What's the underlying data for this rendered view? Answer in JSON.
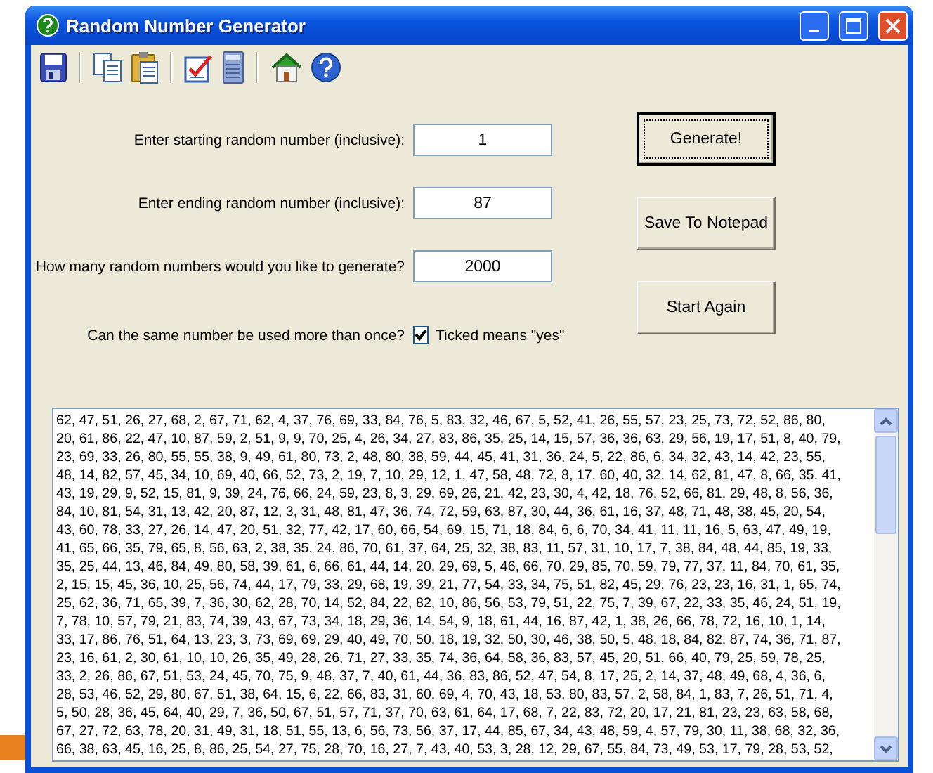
{
  "window": {
    "title": "Random Number Generator"
  },
  "toolbar": [
    {
      "kind": "save"
    },
    {
      "kind": "separator"
    },
    {
      "kind": "copy"
    },
    {
      "kind": "paste"
    },
    {
      "kind": "separator"
    },
    {
      "kind": "checklist"
    },
    {
      "kind": "calculator"
    },
    {
      "kind": "separator"
    },
    {
      "kind": "home"
    },
    {
      "kind": "help"
    }
  ],
  "fields": [
    {
      "label": "Enter starting random number (inclusive):",
      "value": "1"
    },
    {
      "label": "Enter ending random number (inclusive):",
      "value": "87"
    },
    {
      "label": "How many random numbers would you like to generate?",
      "value": "2000"
    }
  ],
  "reuse": {
    "label": "Can the same number be used more than once?",
    "checkbox_label": "Ticked means \"yes\"",
    "checked": true
  },
  "buttons": [
    {
      "label": "Generate!",
      "default": true
    },
    {
      "label": "Save To Notepad",
      "default": false
    },
    {
      "label": "Start Again",
      "default": false
    }
  ],
  "output": {
    "lines": [
      "62, 47, 51, 26, 27, 68, 2, 67, 71, 62, 4, 37, 76, 69, 33, 84, 76, 5, 83, 32, 46, 67, 5, 52, 41, 26, 55, 57, 23, 25, 73, 72, 52, 86, 80,",
      "20, 61, 86, 22, 47, 10, 87, 59, 2, 51, 9, 9, 70, 25, 4, 26, 34, 27, 83, 86, 35, 25, 14, 15, 57, 36, 36, 63, 29, 56, 19, 17, 51, 8, 40, 79,",
      "23, 69, 33, 26, 80, 55, 55, 38, 9, 49, 61, 80, 73, 2, 48, 80, 38, 59, 44, 45, 41, 31, 36, 24, 5, 22, 86, 6, 34, 32, 43, 14, 42, 23, 55,",
      "48, 14, 82, 57, 45, 34, 10, 69, 40, 66, 52, 73, 2, 19, 7, 10, 29, 12, 1, 47, 58, 48, 72, 8, 17, 60, 40, 32, 14, 62, 81, 47, 8, 66, 35, 41,",
      "43, 19, 29, 9, 52, 15, 81, 9, 39, 24, 76, 66, 24, 59, 23, 8, 3, 29, 69, 26, 21, 42, 23, 30, 4, 42, 18, 76, 52, 66, 81, 29, 48, 8, 56, 36,",
      "84, 10, 81, 54, 31, 13, 42, 20, 87, 12, 3, 31, 48, 81, 47, 36, 74, 72, 59, 63, 87, 30, 44, 36, 61, 16, 37, 48, 71, 48, 38, 45, 20, 54,",
      "43, 60, 78, 33, 27, 26, 14, 47, 20, 51, 32, 77, 42, 17, 60, 66, 54, 69, 15, 71, 18, 84, 6, 6, 70, 34, 41, 11, 11, 16, 5, 63, 47, 49, 19,",
      "41, 65, 66, 35, 79, 65, 8, 56, 63, 2, 38, 35, 24, 86, 70, 61, 37, 64, 25, 32, 38, 83, 11, 57, 31, 10, 17, 7, 38, 84, 48, 44, 85, 19, 33,",
      "35, 25, 44, 13, 46, 84, 49, 80, 58, 39, 61, 6, 66, 61, 44, 14, 20, 29, 69, 5, 46, 66, 70, 29, 85, 70, 59, 79, 77, 37, 11, 84, 70, 61, 35,",
      "2, 15, 15, 45, 36, 10, 25, 56, 74, 44, 17, 79, 33, 29, 68, 19, 39, 21, 77, 54, 33, 34, 75, 51, 82, 45, 29, 76, 23, 23, 16, 31, 1, 65, 74,",
      "25, 62, 36, 71, 65, 39, 7, 36, 30, 62, 28, 70, 14, 52, 84, 22, 82, 10, 86, 56, 53, 79, 51, 22, 75, 7, 39, 67, 22, 33, 35, 46, 24, 51, 19,",
      "7, 78, 10, 57, 79, 21, 83, 74, 39, 43, 67, 73, 34, 18, 29, 36, 14, 54, 9, 18, 61, 44, 16, 87, 42, 1, 38, 26, 66, 78, 72, 16, 10, 1, 14,",
      "33, 17, 86, 76, 51, 64, 13, 23, 3, 73, 69, 69, 29, 40, 49, 70, 50, 18, 19, 32, 50, 30, 46, 38, 50, 5, 48, 18, 84, 82, 87, 74, 36, 71, 87,",
      "23, 16, 61, 2, 30, 61, 10, 10, 26, 35, 49, 28, 26, 71, 27, 33, 35, 74, 36, 64, 58, 36, 83, 57, 45, 20, 51, 66, 40, 79, 25, 59, 78, 25,",
      "33, 2, 26, 86, 67, 51, 53, 24, 45, 70, 75, 9, 48, 37, 7, 40, 61, 44, 36, 83, 86, 52, 47, 54, 8, 17, 25, 2, 14, 37, 48, 49, 68, 4, 36, 6,",
      "28, 53, 46, 52, 29, 80, 67, 51, 38, 64, 15, 6, 22, 66, 83, 31, 60, 69, 4, 70, 43, 18, 53, 80, 83, 57, 2, 58, 84, 1, 83, 7, 26, 51, 71, 4,",
      "5, 50, 28, 36, 45, 64, 40, 29, 7, 36, 50, 67, 51, 57, 71, 37, 70, 63, 61, 64, 17, 68, 7, 22, 83, 72, 20, 17, 21, 81, 23, 23, 63, 58, 68,",
      "67, 27, 72, 63, 78, 20, 31, 49, 31, 18, 51, 55, 13, 6, 56, 73, 56, 37, 17, 44, 85, 67, 34, 43, 48, 59, 4, 57, 79, 30, 11, 38, 68, 32, 36,",
      "66, 38, 63, 45, 16, 25, 8, 86, 25, 54, 27, 75, 28, 70, 16, 27, 7, 43, 40, 53, 3, 28, 12, 29, 67, 55, 84, 73, 49, 53, 17, 79, 28, 53, 52,"
    ]
  }
}
